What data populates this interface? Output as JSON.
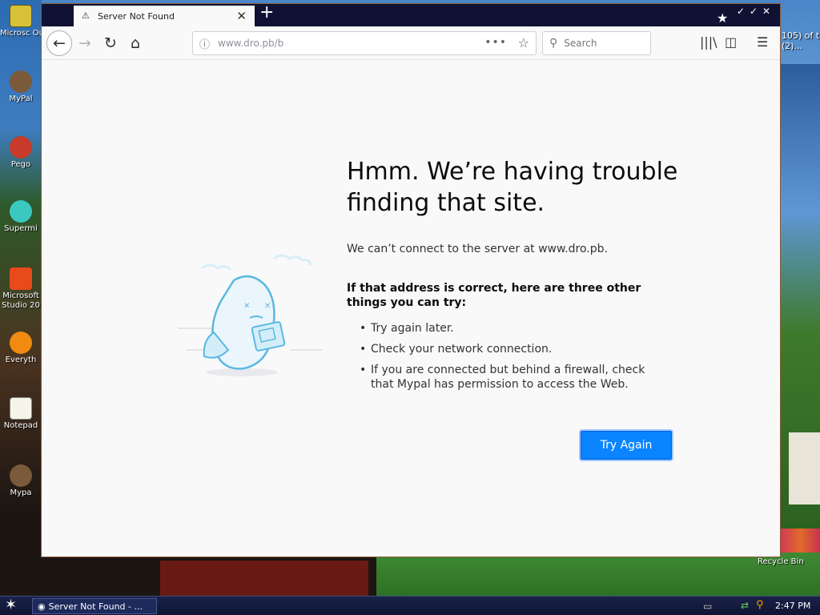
{
  "browser": {
    "tab_title": "Server Not Found",
    "url": "www.dro.pb/b",
    "search_placeholder": "Search"
  },
  "error_page": {
    "title": "Hmm. We’re having trouble finding that site.",
    "description": "We can’t connect to the server at www.dro.pb.",
    "suggestion_heading": "If that address is correct, here are three other things you can try:",
    "suggestions": [
      "Try again later.",
      "Check your network connection.",
      "If you are connected but behind a firewall, check that Mypal has permission to access the Web."
    ],
    "try_again_label": "Try Again"
  },
  "desktop": {
    "icons": [
      {
        "label": "Microsc Outloo"
      },
      {
        "label": "MyPal"
      },
      {
        "label": "Pego"
      },
      {
        "label": "Supermi"
      },
      {
        "label": "Microsoft Studio 20"
      },
      {
        "label": "Everyth"
      },
      {
        "label": "Notepad"
      },
      {
        "label": "Mypa"
      }
    ],
    "right_edge_text": "105) of t (2)...",
    "recycle_bin_label": "Recycle Bin"
  },
  "taskbar": {
    "task_label": "Server Not Found - ...",
    "clock": "2:47 PM"
  }
}
